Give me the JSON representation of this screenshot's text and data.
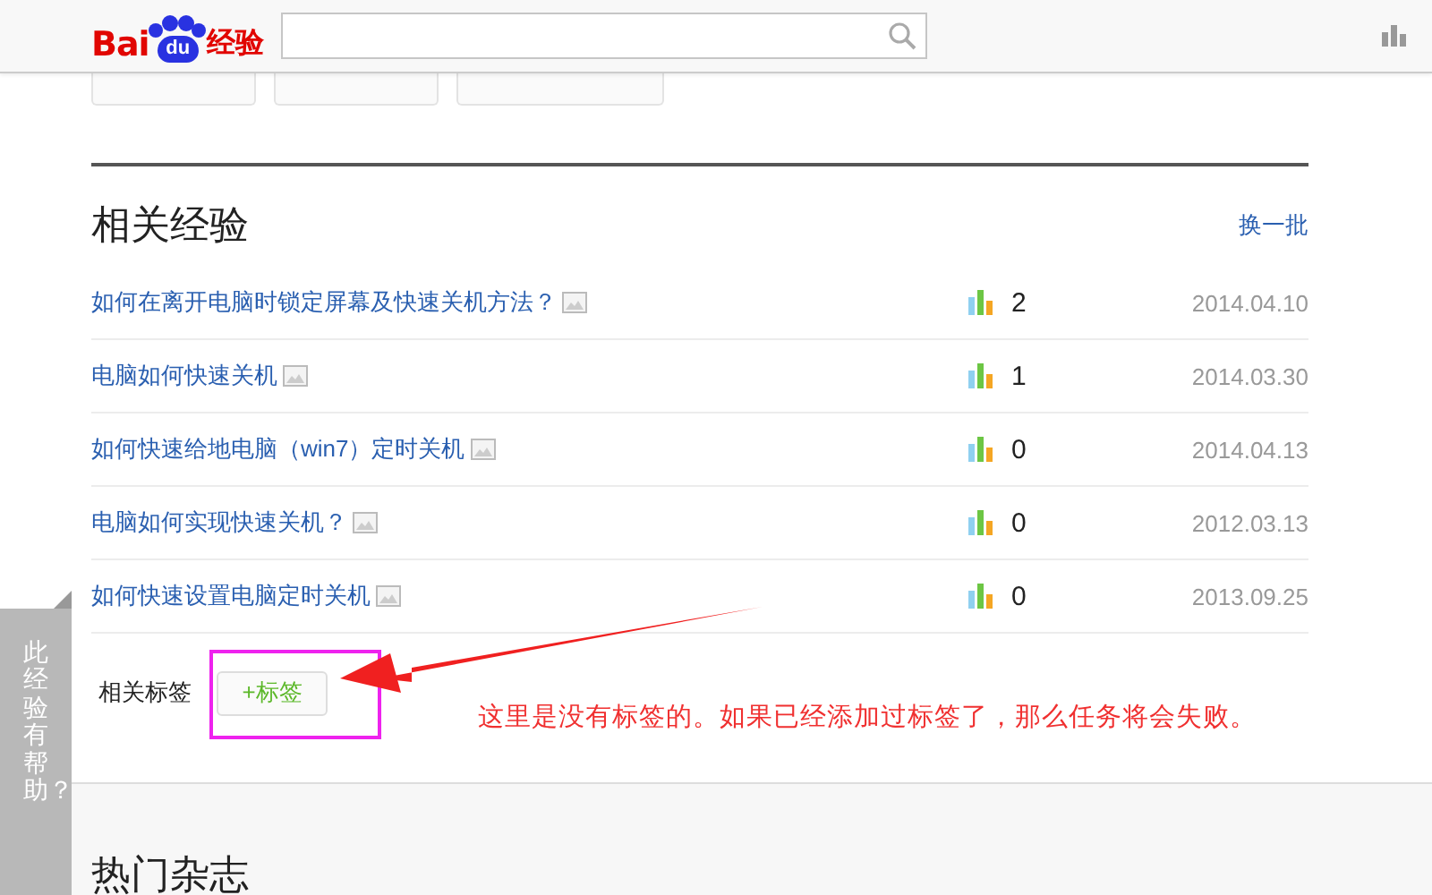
{
  "header": {
    "logo": [
      "Bai",
      "du",
      "经验"
    ]
  },
  "related": {
    "title": "相关经验",
    "refresh": "换一批",
    "rows": [
      {
        "title": "如何在离开电脑时锁定屏幕及快速关机方法？",
        "count": "2",
        "date": "2014.04.10"
      },
      {
        "title": "电脑如何快速关机",
        "count": "1",
        "date": "2014.03.30"
      },
      {
        "title": "如何快速给地电脑（win7）定时关机",
        "count": "0",
        "date": "2014.04.13"
      },
      {
        "title": "电脑如何实现快速关机？",
        "count": "0",
        "date": "2012.03.13"
      },
      {
        "title": "如何快速设置电脑定时关机",
        "count": "0",
        "date": "2013.09.25"
      }
    ]
  },
  "tags": {
    "label": "相关标签",
    "add_button": "+标签"
  },
  "annotation": "这里是没有标签的。如果已经添加过标签了，那么任务将会失败。",
  "side_tab": "此经验有帮助？",
  "magazines": {
    "title": "热门杂志"
  }
}
